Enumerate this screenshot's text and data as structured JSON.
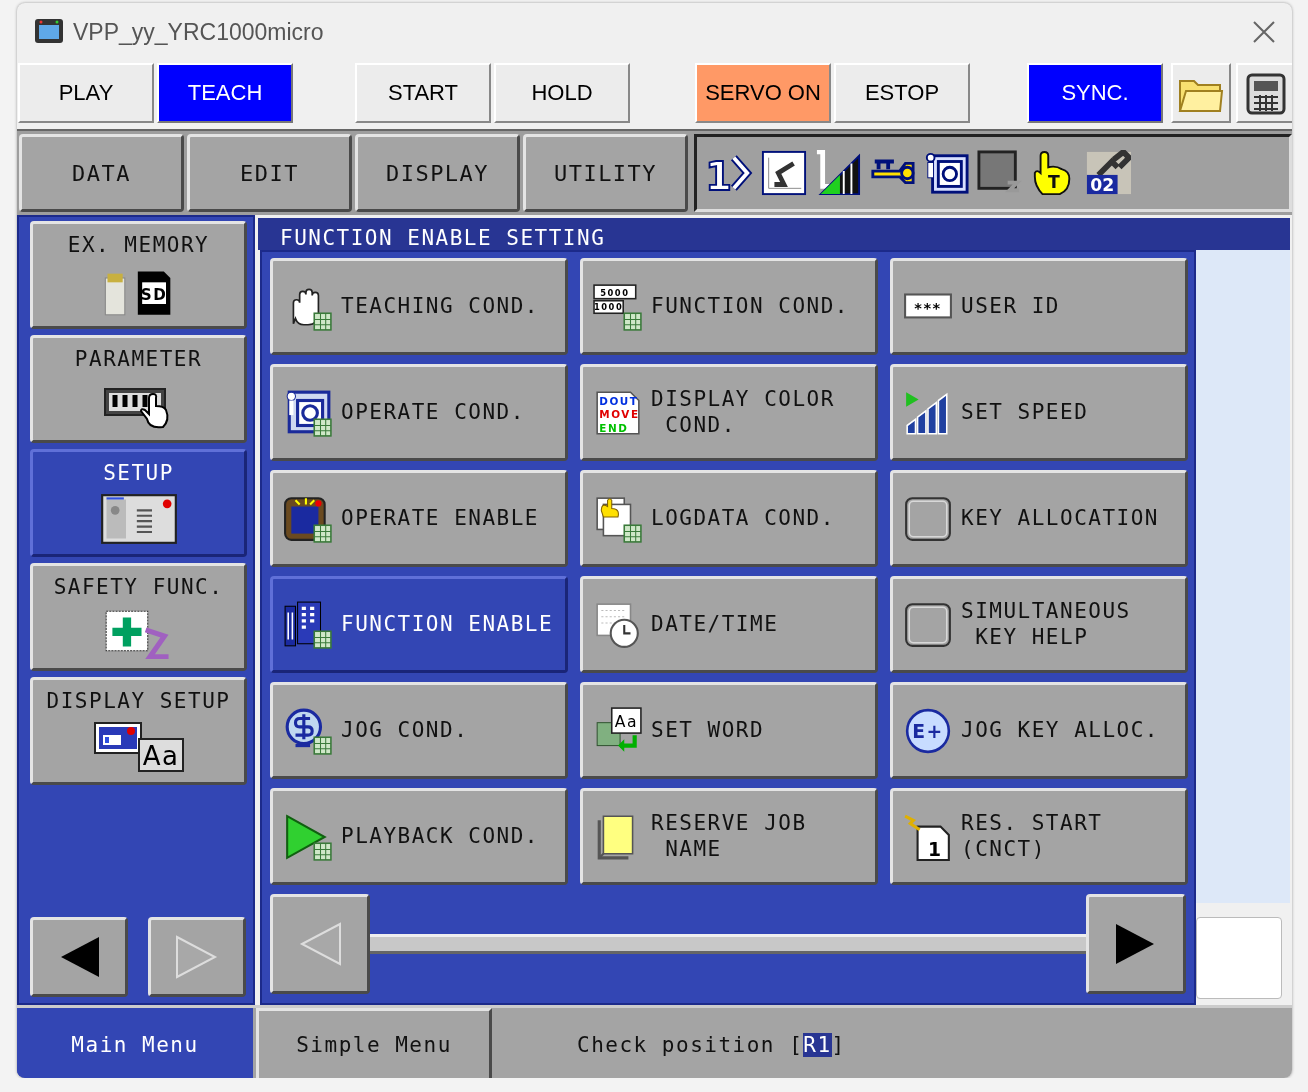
{
  "window": {
    "title": "VPP_yy_YRC1000micro"
  },
  "top_groups": [
    {
      "buttons": [
        {
          "label": "PLAY",
          "kind": "mode",
          "selected": false
        },
        {
          "label": "TEACH",
          "kind": "mode",
          "selected": true
        }
      ]
    },
    {
      "buttons": [
        {
          "label": "START",
          "kind": "action"
        },
        {
          "label": "HOLD",
          "kind": "action"
        }
      ]
    },
    {
      "buttons": [
        {
          "label": "SERVO ON",
          "kind": "servo",
          "on": true
        },
        {
          "label": "ESTOP",
          "kind": "action"
        }
      ]
    },
    {
      "buttons": [
        {
          "label": "SYNC.",
          "kind": "sync",
          "on": true
        }
      ]
    }
  ],
  "menu_tabs": [
    {
      "label": "DATA"
    },
    {
      "label": "EDIT"
    },
    {
      "label": "DISPLAY"
    },
    {
      "label": "UTILITY"
    }
  ],
  "status_bar": {
    "frame_number": "1",
    "hand_letter": "T",
    "tool_number": "02"
  },
  "side_menu": {
    "items": [
      {
        "label": "EX. MEMORY",
        "icon_text": "SD",
        "selected": false
      },
      {
        "label": "PARAMETER",
        "selected": false
      },
      {
        "label": "SETUP",
        "selected": true
      },
      {
        "label": "SAFETY FUNC.",
        "selected": false
      },
      {
        "label": "DISPLAY SETUP",
        "icon_text": "Aa",
        "selected": false
      }
    ],
    "prev_disabled": false,
    "next_disabled": true
  },
  "panel": {
    "title": "FUNCTION ENABLE SETTING",
    "items": [
      {
        "label": "TEACHING COND.",
        "selected": false
      },
      {
        "label": "FUNCTION COND.",
        "icon_text": [
          "5000",
          "1000"
        ],
        "selected": false
      },
      {
        "label": "USER ID",
        "icon_text": "***",
        "selected": false
      },
      {
        "label": "OPERATE COND.",
        "selected": false
      },
      {
        "label": "DISPLAY COLOR\n COND.",
        "icon_text": [
          "DOUT",
          "MOVE",
          "END"
        ],
        "selected": false
      },
      {
        "label": "SET SPEED",
        "selected": false
      },
      {
        "label": "OPERATE ENABLE",
        "selected": false
      },
      {
        "label": "LOGDATA COND.",
        "selected": false
      },
      {
        "label": "KEY ALLOCATION",
        "selected": false
      },
      {
        "label": "FUNCTION ENABLE",
        "selected": true
      },
      {
        "label": "DATE/TIME",
        "selected": false
      },
      {
        "label": "SIMULTANEOUS\n KEY HELP",
        "selected": false
      },
      {
        "label": "JOG COND.",
        "selected": false
      },
      {
        "label": "SET WORD",
        "icon_text": "Aa",
        "selected": false
      },
      {
        "label": "JOG KEY ALLOC.",
        "icon_text": "E+",
        "selected": false
      },
      {
        "label": "PLAYBACK COND.",
        "selected": false
      },
      {
        "label": "RESERVE JOB\n NAME",
        "selected": false
      },
      {
        "label": "RES. START\n(CNCT)",
        "icon_text": "1",
        "selected": false
      }
    ],
    "prev_disabled": true,
    "next_disabled": false
  },
  "bottom_tabs": [
    {
      "label": "Main Menu",
      "selected": true
    },
    {
      "label": "Simple Menu",
      "selected": false
    }
  ],
  "message": {
    "before": "Check position [",
    "marked": "R1",
    "after": "]"
  }
}
